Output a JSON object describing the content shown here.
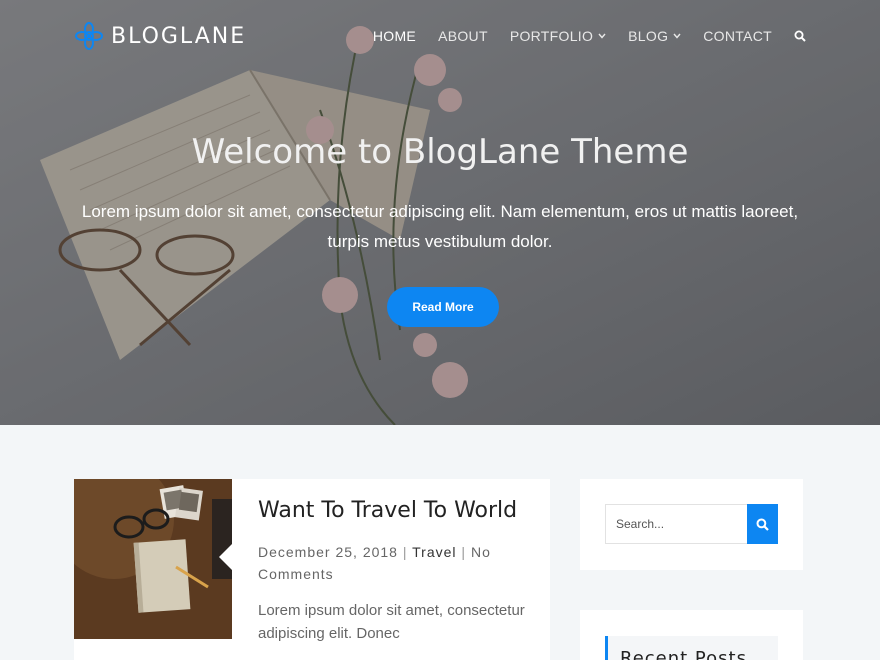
{
  "site": {
    "logo_text": "BLOGLANE"
  },
  "nav": {
    "items": [
      {
        "label": "HOME"
      },
      {
        "label": "ABOUT"
      },
      {
        "label": "PORTFOLIO"
      },
      {
        "label": "BLOG"
      },
      {
        "label": "CONTACT"
      }
    ]
  },
  "hero": {
    "title": "Welcome to BlogLane Theme",
    "subtitle": "Lorem ipsum dolor sit amet, consectetur adipiscing elit. Nam elementum, eros ut mattis laoreet, turpis metus vestibulum dolor.",
    "button_label": "Read More"
  },
  "post": {
    "title": "Want To Travel To World",
    "date": "December 25, 2018",
    "category": "Travel",
    "comments": "No Comments",
    "excerpt": "Lorem ipsum dolor sit amet, consectetur adipiscing elit. Donec"
  },
  "sidebar": {
    "search": {
      "placeholder": "Search..."
    },
    "recent_posts_title": "Recent Posts"
  },
  "colors": {
    "accent": "#0d86f2",
    "page_background": "#f3f6f8",
    "card_background": "#ffffff"
  },
  "icons": {
    "logo": "flower-logo-icon",
    "dropdown": "chevron-down-icon",
    "search": "search-icon"
  }
}
